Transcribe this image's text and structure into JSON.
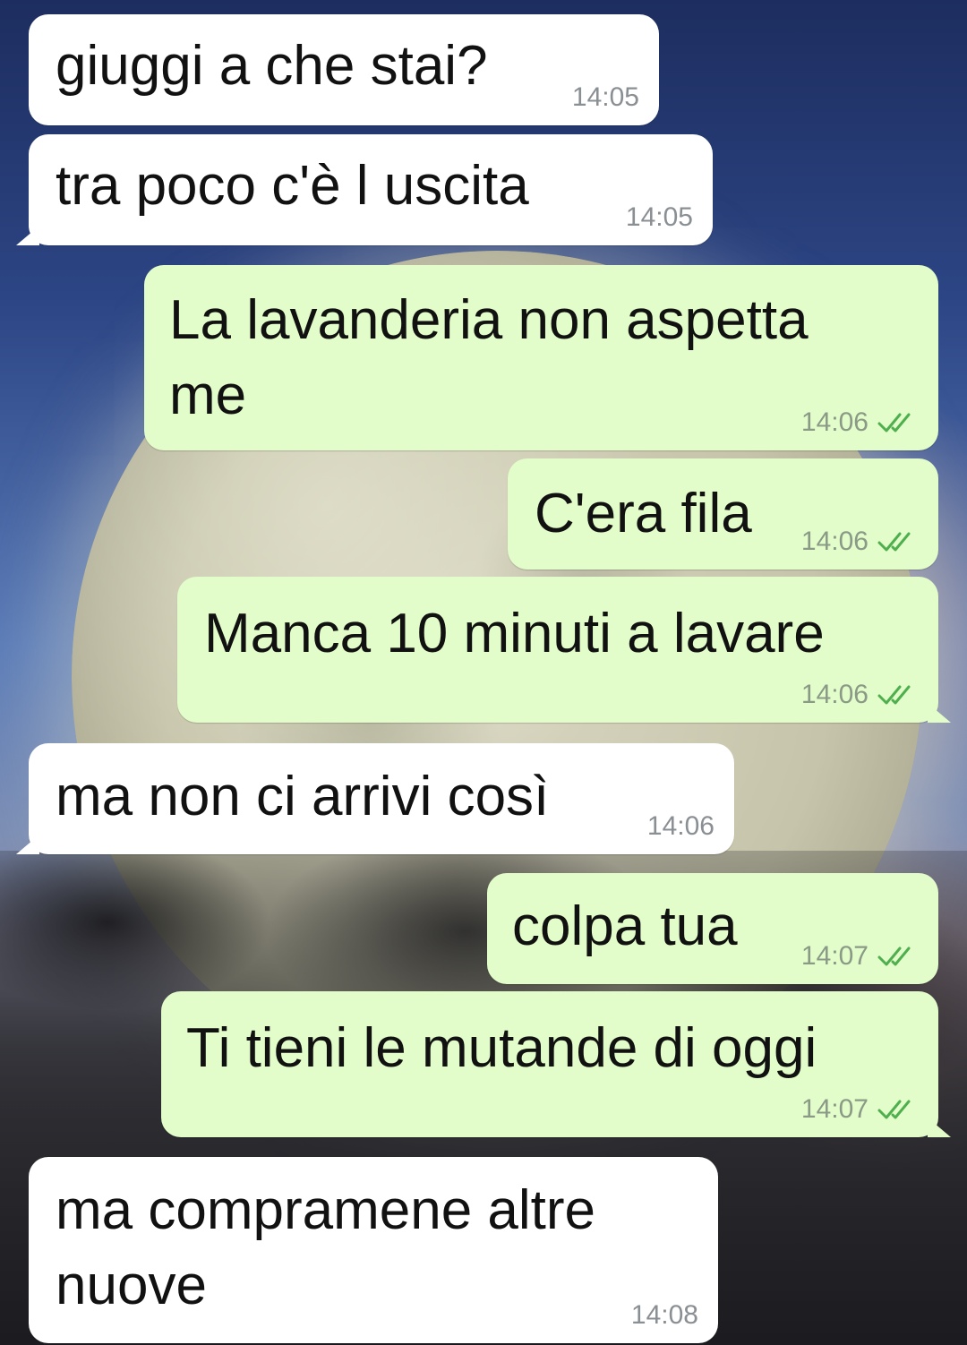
{
  "messages": [
    {
      "text": "giuggi a che stai?",
      "time": "14:05",
      "direction": "incoming"
    },
    {
      "text": "tra poco c'è l uscita",
      "time": "14:05",
      "direction": "incoming"
    },
    {
      "text_lines": [
        "La lavanderia non aspetta",
        "me"
      ],
      "time": "14:06",
      "direction": "outgoing",
      "status": "read"
    },
    {
      "text": "C'era fila",
      "time": "14:06",
      "direction": "outgoing",
      "status": "read"
    },
    {
      "text": "Manca 10 minuti a lavare",
      "time": "14:06",
      "direction": "outgoing",
      "status": "read"
    },
    {
      "text": "ma non ci arrivi così",
      "time": "14:06",
      "direction": "incoming"
    },
    {
      "text": "colpa tua",
      "time": "14:07",
      "direction": "outgoing",
      "status": "read"
    },
    {
      "text": "Ti tieni le mutande di oggi",
      "time": "14:07",
      "direction": "outgoing",
      "status": "read"
    },
    {
      "text_lines": [
        "ma compramene altre",
        "nuove"
      ],
      "time": "14:08",
      "direction": "incoming"
    }
  ],
  "colors": {
    "incoming_bubble": "#ffffff",
    "outgoing_bubble": "#e2fdc9",
    "read_ticks": "#4fae4e",
    "timestamp": "#8a8f93"
  },
  "icons": {
    "read_status": "double-check-icon"
  }
}
